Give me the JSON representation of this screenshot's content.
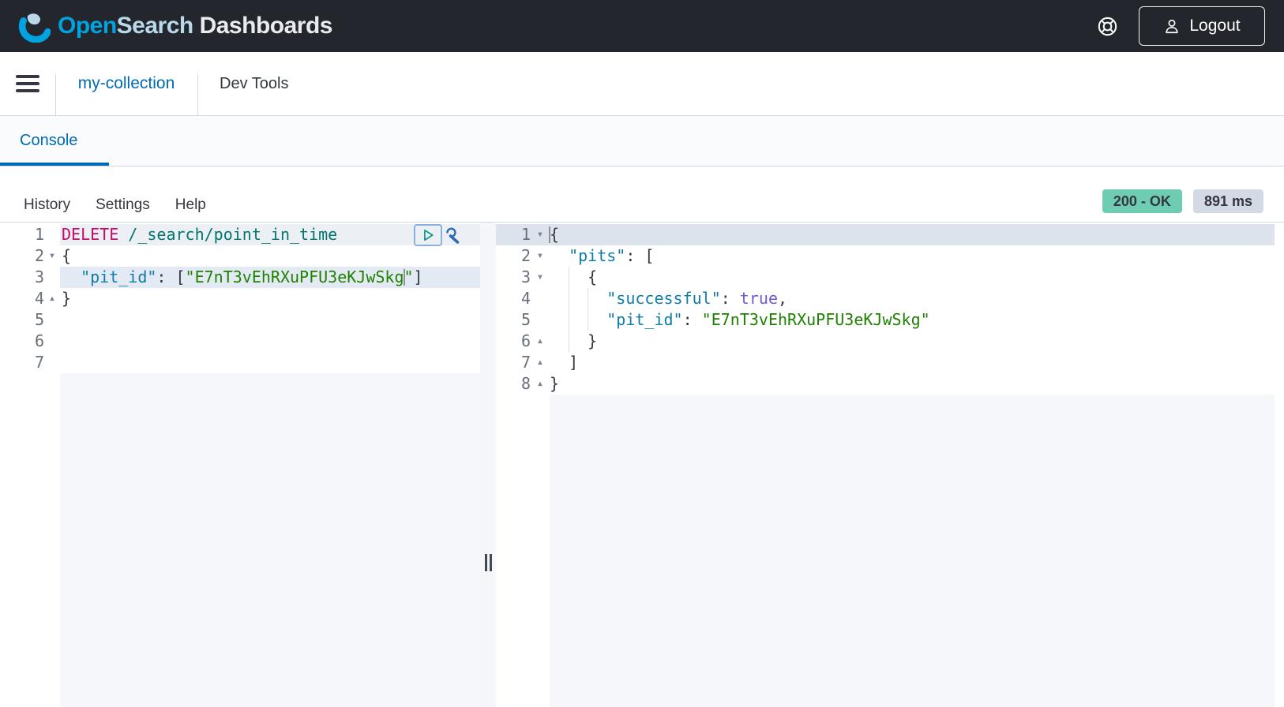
{
  "header": {
    "logo_part1": "Open",
    "logo_part2": "Search",
    "logo_part3": " Dashboards",
    "logout_label": "Logout"
  },
  "nav": {
    "collection_label": "my-collection",
    "devtools_label": "Dev Tools"
  },
  "tabs": {
    "console_label": "Console"
  },
  "toolbar": {
    "items": [
      {
        "label": "History"
      },
      {
        "label": "Settings"
      },
      {
        "label": "Help"
      }
    ],
    "status_badge": "200 - OK",
    "time_badge": "891 ms"
  },
  "colors": {
    "header_bg": "#23262c",
    "brand_blue": "#00a3e0",
    "link_blue": "#006bb4",
    "border": "#d3dae6",
    "status_green": "#6dccb1",
    "badge_gray": "#d3dae6",
    "method_pink": "#c80a68",
    "url_teal": "#00756c",
    "key_blue": "#0d7ca6",
    "string_green": "#1e8102",
    "boolean_purple": "#6a5ad8",
    "active_line_request": "#e4eaf3",
    "active_line_response": "#dde3ec"
  },
  "request_editor": {
    "lines": [
      {
        "num": 1,
        "fold": null,
        "hl": "req",
        "tokens": [
          {
            "c": "method",
            "t": "DELETE"
          },
          {
            "c": "plain",
            "t": " "
          },
          {
            "c": "url",
            "t": "/_search/point_in_time"
          }
        ]
      },
      {
        "num": 2,
        "fold": "down",
        "hl": null,
        "tokens": [
          {
            "c": "plain",
            "t": "{"
          }
        ]
      },
      {
        "num": 3,
        "fold": null,
        "hl": "active",
        "tokens": [
          {
            "c": "plain",
            "t": "  "
          },
          {
            "c": "key",
            "t": "\"pit_id\""
          },
          {
            "c": "plain",
            "t": ": ["
          },
          {
            "c": "str",
            "t": "\"E7nT3vEhRXuPFU3eKJwSkg"
          },
          {
            "c": "cursor",
            "t": ""
          },
          {
            "c": "str",
            "t": "\""
          },
          {
            "c": "plain",
            "t": "]"
          }
        ]
      },
      {
        "num": 4,
        "fold": "up",
        "hl": null,
        "tokens": [
          {
            "c": "plain",
            "t": "}"
          }
        ]
      },
      {
        "num": 5,
        "fold": null,
        "hl": null,
        "tokens": []
      },
      {
        "num": 6,
        "fold": null,
        "hl": null,
        "tokens": []
      },
      {
        "num": 7,
        "fold": null,
        "hl": null,
        "tokens": []
      }
    ]
  },
  "response_editor": {
    "lines": [
      {
        "num": 1,
        "fold": "down",
        "hl": "active",
        "tokens": [
          {
            "c": "cursor",
            "t": ""
          },
          {
            "c": "plain",
            "t": "{"
          }
        ]
      },
      {
        "num": 2,
        "fold": "down",
        "hl": null,
        "tokens": [
          {
            "c": "plain",
            "t": "  "
          },
          {
            "c": "key",
            "t": "\"pits\""
          },
          {
            "c": "plain",
            "t": ": ["
          }
        ]
      },
      {
        "num": 3,
        "fold": "down",
        "hl": null,
        "guides": [
          2
        ],
        "tokens": [
          {
            "c": "plain",
            "t": "    {"
          }
        ]
      },
      {
        "num": 4,
        "fold": null,
        "hl": null,
        "guides": [
          2,
          4
        ],
        "tokens": [
          {
            "c": "plain",
            "t": "      "
          },
          {
            "c": "key",
            "t": "\"successful\""
          },
          {
            "c": "plain",
            "t": ": "
          },
          {
            "c": "bool",
            "t": "true"
          },
          {
            "c": "plain",
            "t": ","
          }
        ]
      },
      {
        "num": 5,
        "fold": null,
        "hl": null,
        "guides": [
          2,
          4
        ],
        "tokens": [
          {
            "c": "plain",
            "t": "      "
          },
          {
            "c": "key",
            "t": "\"pit_id\""
          },
          {
            "c": "plain",
            "t": ": "
          },
          {
            "c": "str",
            "t": "\"E7nT3vEhRXuPFU3eKJwSkg\""
          }
        ]
      },
      {
        "num": 6,
        "fold": "up",
        "hl": null,
        "guides": [
          2
        ],
        "tokens": [
          {
            "c": "plain",
            "t": "    }"
          }
        ]
      },
      {
        "num": 7,
        "fold": "up",
        "hl": null,
        "tokens": [
          {
            "c": "plain",
            "t": "  ]"
          }
        ]
      },
      {
        "num": 8,
        "fold": "up",
        "hl": null,
        "tokens": [
          {
            "c": "plain",
            "t": "}"
          }
        ]
      }
    ]
  }
}
